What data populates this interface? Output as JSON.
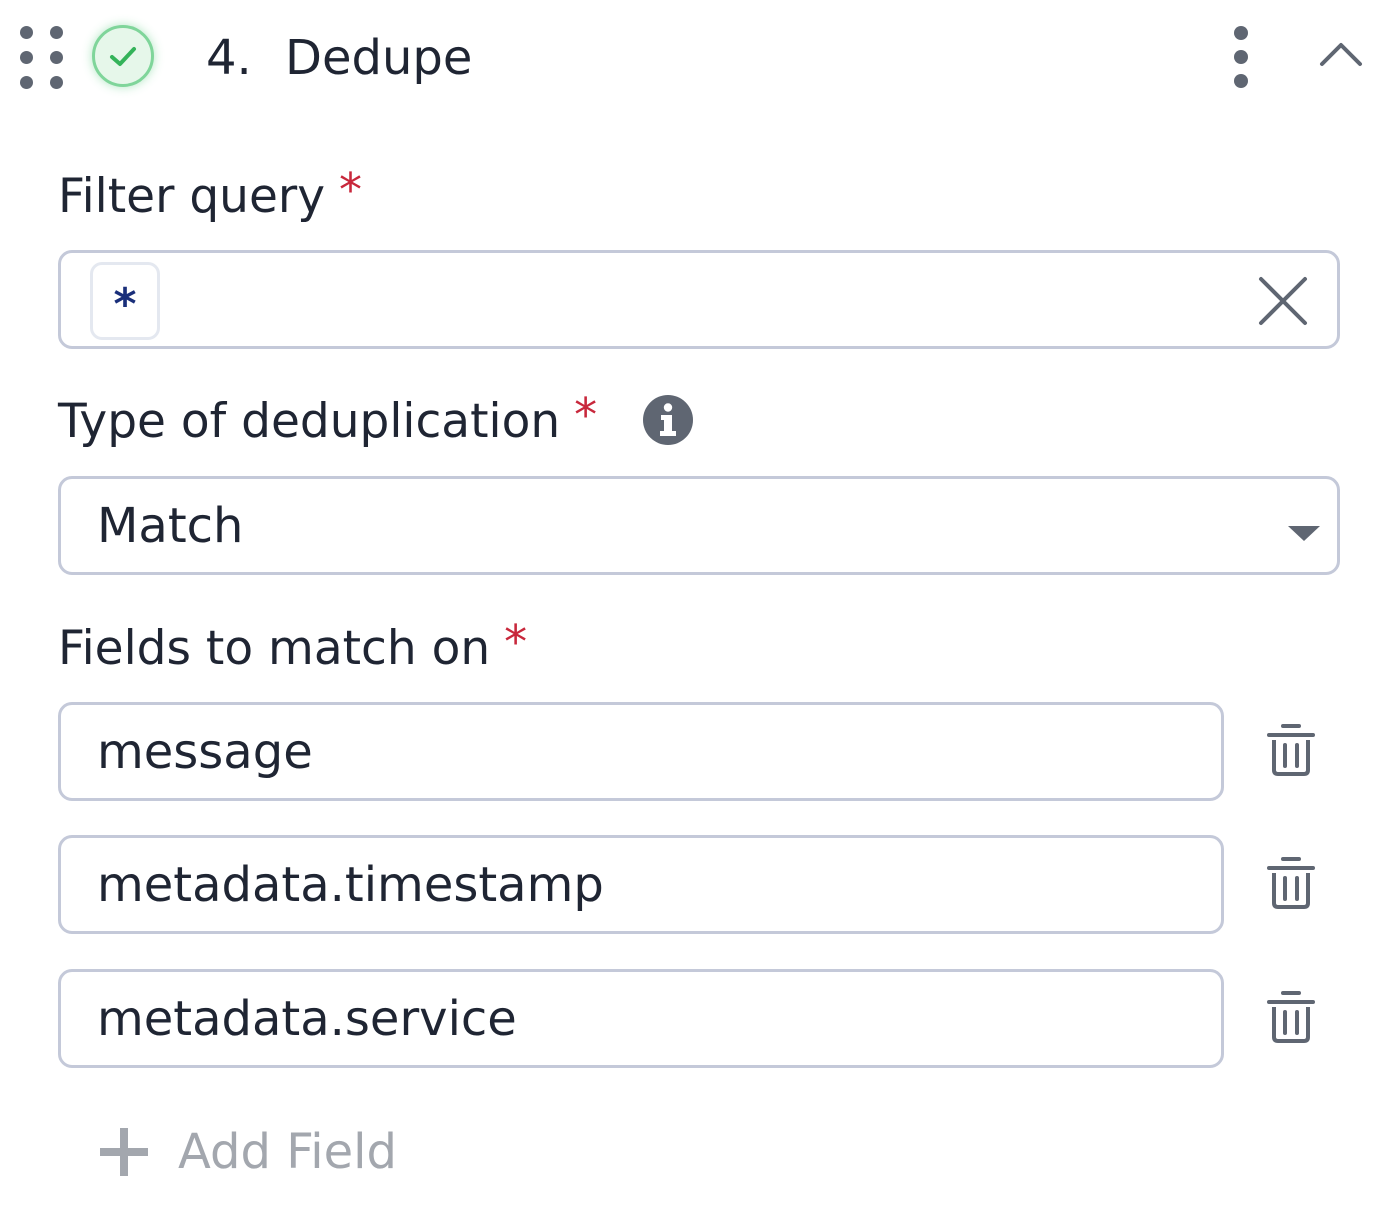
{
  "header": {
    "step_number": "4.",
    "step_title": "Dedupe",
    "status_icon": "check-circle-icon",
    "colors": {
      "status_green": "#34b35a"
    }
  },
  "filter_query": {
    "label": "Filter query",
    "required_mark": "*",
    "chip_value": "*"
  },
  "dedup_type": {
    "label": "Type of deduplication",
    "required_mark": "*",
    "selected": "Match"
  },
  "fields": {
    "label": "Fields to match on",
    "required_mark": "*",
    "items": [
      {
        "value": "message"
      },
      {
        "value": "metadata.timestamp"
      },
      {
        "value": "metadata.service"
      }
    ],
    "add_label": "Add Field"
  },
  "colors": {
    "required": "#c8283c",
    "border": "#c4c9d9",
    "text": "#1f2533",
    "muted": "#a3a7ae"
  }
}
